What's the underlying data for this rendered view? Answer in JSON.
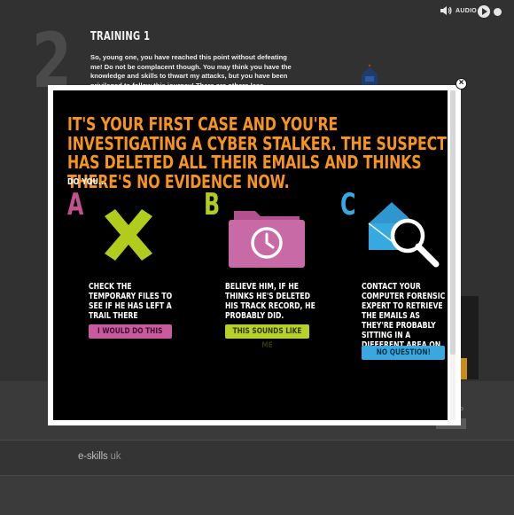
{
  "background": {
    "step_number": "2",
    "title": "TRAINING 1",
    "intro_text": "So, young one, you have reached this point without defeating me! Do not be complacent though. You may think you have the knowledge and skills to thwart my attacks, but you have been privileged to follow this journey! There are others less",
    "audio_label": "AUDIO",
    "brand": "e-skills",
    "brand_suffix": "uk",
    "map_label": "ap"
  },
  "modal": {
    "headline": "IT'S YOUR FIRST CASE AND YOU'RE INVESTIGATING A CYBER STALKER. THE SUSPECT HAS DELETED ALL THEIR EMAILS AND THINKS THERE'S NO EVIDENCE NOW.",
    "prompt": "DO YOU...",
    "close_icon": "close-icon",
    "options": [
      {
        "letter": "A",
        "color": "#c0528f",
        "icon": "x-cross-icon",
        "icon_color": "#b2cc1e",
        "text": "CHECK THE TEMPORARY FILES TO SEE IF HE HAS LEFT A TRAIL THERE",
        "button": "I WOULD DO THIS",
        "button_color": "#c85a9e"
      },
      {
        "letter": "B",
        "color": "#b2cc1e",
        "icon": "folder-clock-icon",
        "icon_color": "#c86aa6",
        "text": "BELIEVE HIM, IF HE THINKS HE'S DELETED HIS TRACK RECORD, HE PROBABLY DID.",
        "button": "THIS SOUNDS LIKE ME",
        "button_color": "#b8d12a"
      },
      {
        "letter": "C",
        "color": "#36a9e1",
        "icon": "envelope-magnifier-icon",
        "icon_color": "#36a9e1",
        "text": "CONTACT YOUR COMPUTER FORENSIC EXPERT TO RETRIEVE THE EMAILS AS THEY'RE PROBABLY SITTING IN A DIFFERENT AREA ON THE HARD DRIVE",
        "button": "NO QUESTION!",
        "button_color": "#3aa8df"
      }
    ]
  }
}
